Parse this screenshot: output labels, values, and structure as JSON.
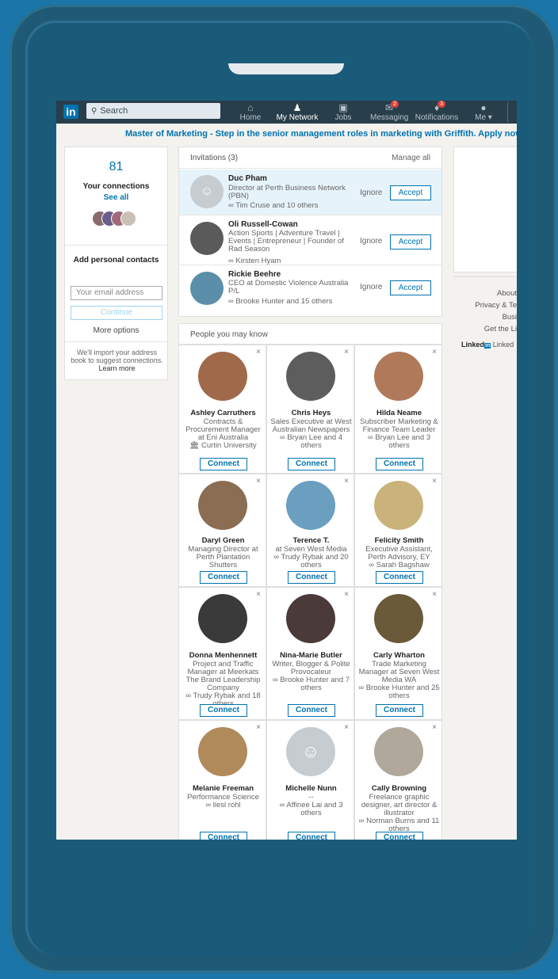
{
  "nav": {
    "logo": "in",
    "search_placeholder": "Search",
    "items": [
      {
        "label": "Home",
        "icon": "home-icon",
        "glyph": "⌂"
      },
      {
        "label": "My Network",
        "icon": "network-icon",
        "glyph": "👥"
      },
      {
        "label": "Jobs",
        "icon": "briefcase-icon",
        "glyph": "▭"
      },
      {
        "label": "Messaging",
        "icon": "messaging-icon",
        "glyph": "✉",
        "badge": "2"
      },
      {
        "label": "Notifications",
        "icon": "bell-icon",
        "glyph": "🔔",
        "badge": "3"
      },
      {
        "label": "Me ▾",
        "icon": "avatar-icon",
        "glyph": "●"
      }
    ]
  },
  "banner": "Master of Marketing - Step in the senior management roles in marketing with Griffith. Apply now",
  "left": {
    "count": "81",
    "connections_label": "Your connections",
    "see_all": "See all",
    "add_contacts": "Add personal contacts",
    "email_placeholder": "Your email address",
    "continue": "Continue",
    "more_options": "More options",
    "import_text": "We'll import your address book to suggest connections.",
    "learn_more": "Learn more"
  },
  "invitations": {
    "title": "Invitations (3)",
    "manage_all": "Manage all",
    "ignore": "Ignore",
    "accept": "Accept",
    "items": [
      {
        "name": "Duc Pham",
        "headline": "Director at Perth Business Network (PBN)",
        "mutual": "Tim Cruse and 10 others"
      },
      {
        "name": "Oli Russell-Cowan",
        "headline": "Action Sports | Adventure Travel | Events | Entrepreneur | Founder of Rad Season",
        "mutual": "Kirsten Hyam"
      },
      {
        "name": "Rickie Beehre",
        "headline": "CEO at Domestic Violence Australia P/L",
        "mutual": "Brooke Hunter and 15 others"
      }
    ]
  },
  "right": {
    "links": [
      "About",
      "Privacy & Te",
      "Busi",
      "Get the Li"
    ],
    "brand": "Linked",
    "brand_tail": "Linked"
  },
  "pymk": {
    "title": "People you may know",
    "connect": "Connect",
    "close": "×",
    "people": [
      {
        "name": "Ashley Carruthers",
        "desc": "Contracts & Procurement Manager at Eni Australia",
        "extra": "🏛 Curtin University",
        "color": "#a06a4a"
      },
      {
        "name": "Chris Heys",
        "desc": "Sales Executive at West Australian Newspapers",
        "extra": "∞ Bryan Lee and 4 others",
        "color": "#5d5d5d"
      },
      {
        "name": "Hilda Neame",
        "desc": "Subscriber Marketing & Finance Team Leader",
        "extra": "∞ Bryan Lee and 3 others",
        "color": "#b07a5a"
      },
      {
        "name": "Daryl Green",
        "desc": "Managing Director at Perth Plantation Shutters",
        "extra": "",
        "color": "#8a6d52"
      },
      {
        "name": "Terence T.",
        "desc": "at Seven West Media",
        "extra": "∞ Trudy Rybak and 20 others",
        "color": "#6a9fc0"
      },
      {
        "name": "Felicity Smith",
        "desc": "Executive Assistant, Perth Advisory, EY",
        "extra": "∞ Sarah Bagshaw",
        "color": "#c9b37a"
      },
      {
        "name": "Donna Menhennett",
        "desc": "Project and Traffic Manager at Meerkats The Brand Leadership Company",
        "extra": "∞ Trudy Rybak and 18 others",
        "color": "#3a3a3a"
      },
      {
        "name": "Nina-Marie Butler",
        "desc": "Writer, Blogger & Polite Provocateur",
        "extra": "∞ Brooke Hunter and 7 others",
        "color": "#4a3a3a"
      },
      {
        "name": "Carly Wharton",
        "desc": "Trade Marketing Manager at Seven West Media WA",
        "extra": "∞ Brooke Hunter and 25 others",
        "color": "#6a5a3a"
      },
      {
        "name": "Melanie Freeman",
        "desc": "Performance Science",
        "extra": "∞ liesl rohl",
        "color": "#b08a5a"
      },
      {
        "name": "Michelle Nunn",
        "desc": "--",
        "extra": "∞ Affinee Lai and 3 others",
        "color": "#c7ccd0"
      },
      {
        "name": "Cally Browning",
        "desc": "Freelance graphic designer, art director & illustrator",
        "extra": "∞ Norman Burns and 11 others",
        "color": "#b0a89a"
      }
    ]
  }
}
